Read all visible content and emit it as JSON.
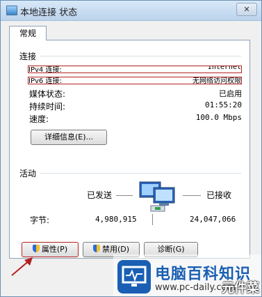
{
  "window": {
    "title": "本地连接 状态",
    "close_label": "✕"
  },
  "tabs": [
    {
      "label": "常规"
    }
  ],
  "connection": {
    "heading": "连接",
    "rows": [
      {
        "label": "IPv4 连接:",
        "value": "Internet"
      },
      {
        "label": "IPv6 连接:",
        "value": "无网络访问权限"
      },
      {
        "label": "媒体状态:",
        "value": "已启用"
      },
      {
        "label": "持续时间:",
        "value": "01:55:20"
      },
      {
        "label": "速度:",
        "value": "100.0 Mbps"
      }
    ],
    "details_button": "详细信息(E)..."
  },
  "activity": {
    "heading": "活动",
    "sent_label": "已发送",
    "received_label": "已接收",
    "bytes_label": "字节:",
    "bytes_sent": "4,980,915",
    "bytes_received": "24,047,066"
  },
  "buttons": {
    "properties": "属性(P)",
    "disable": "禁用(D)",
    "diagnose": "诊断(G)"
  },
  "watermark": {
    "title": "电脑百科知识",
    "url": "www.pc-daily.com",
    "badge": "元件菜"
  },
  "colors": {
    "highlight_border": "#b22020",
    "annotation_arrow": "#b22020",
    "watermark_brand": "#1a5fb4"
  }
}
